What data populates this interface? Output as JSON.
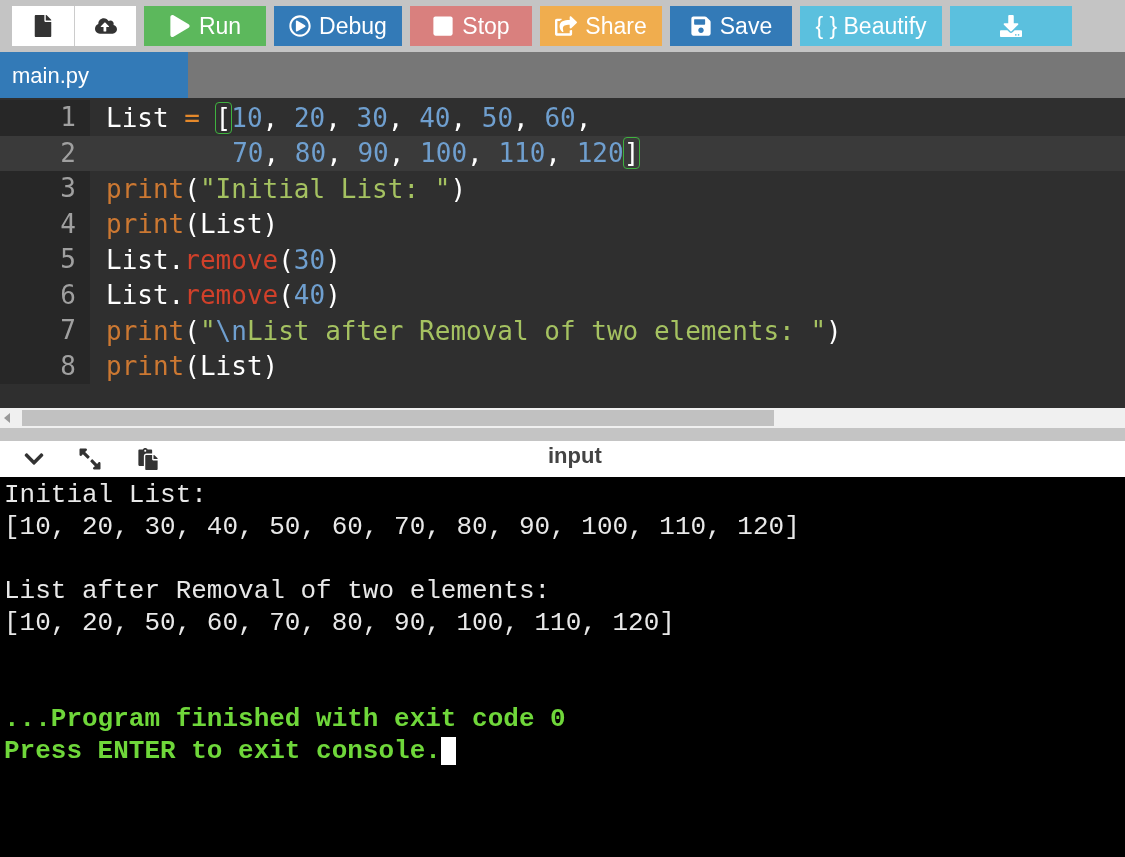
{
  "toolbar": [
    {
      "kind": "new"
    },
    {
      "kind": "upload"
    },
    {
      "kind": "run",
      "label": "Run"
    },
    {
      "kind": "debug",
      "label": "Debug"
    },
    {
      "kind": "stop",
      "label": "Stop"
    },
    {
      "kind": "share",
      "label": "Share"
    },
    {
      "kind": "save",
      "label": "Save"
    },
    {
      "kind": "beautify",
      "label": "{ } Beautify"
    },
    {
      "kind": "download"
    }
  ],
  "tabs": [
    {
      "label": "main.py",
      "selected": true
    }
  ],
  "editor": {
    "lines": [
      {
        "number": "1",
        "tokens": [
          {
            "kind": "plain",
            "text": "List "
          },
          {
            "kind": "op",
            "text": "= "
          },
          {
            "kind": "match",
            "text": "["
          },
          {
            "kind": "num",
            "text": "10"
          },
          {
            "kind": "plain",
            "text": ", "
          },
          {
            "kind": "num",
            "text": "20"
          },
          {
            "kind": "plain",
            "text": ", "
          },
          {
            "kind": "num",
            "text": "30"
          },
          {
            "kind": "plain",
            "text": ", "
          },
          {
            "kind": "num",
            "text": "40"
          },
          {
            "kind": "plain",
            "text": ", "
          },
          {
            "kind": "num",
            "text": "50"
          },
          {
            "kind": "plain",
            "text": ", "
          },
          {
            "kind": "num",
            "text": "60"
          },
          {
            "kind": "plain",
            "text": ","
          }
        ]
      },
      {
        "number": "2",
        "current": true,
        "tokens": [
          {
            "kind": "indent"
          },
          {
            "kind": "num",
            "text": "70"
          },
          {
            "kind": "plain",
            "text": ", "
          },
          {
            "kind": "num",
            "text": "80"
          },
          {
            "kind": "plain",
            "text": ", "
          },
          {
            "kind": "num",
            "text": "90"
          },
          {
            "kind": "plain",
            "text": ", "
          },
          {
            "kind": "num",
            "text": "100"
          },
          {
            "kind": "plain",
            "text": ", "
          },
          {
            "kind": "num",
            "text": "110"
          },
          {
            "kind": "plain",
            "text": ", "
          },
          {
            "kind": "num",
            "text": "120"
          },
          {
            "kind": "match",
            "text": "]"
          }
        ]
      },
      {
        "number": "3",
        "tokens": [
          {
            "kind": "builtin",
            "text": "print"
          },
          {
            "kind": "plain",
            "text": "("
          },
          {
            "kind": "str",
            "text": "\"Initial List: \""
          },
          {
            "kind": "plain",
            "text": ")"
          }
        ]
      },
      {
        "number": "4",
        "tokens": [
          {
            "kind": "builtin",
            "text": "print"
          },
          {
            "kind": "plain",
            "text": "(List)"
          }
        ]
      },
      {
        "number": "5",
        "tokens": [
          {
            "kind": "plain",
            "text": "List."
          },
          {
            "kind": "method",
            "text": "remove"
          },
          {
            "kind": "plain",
            "text": "("
          },
          {
            "kind": "num",
            "text": "30"
          },
          {
            "kind": "plain",
            "text": ")"
          }
        ]
      },
      {
        "number": "6",
        "tokens": [
          {
            "kind": "plain",
            "text": "List."
          },
          {
            "kind": "method",
            "text": "remove"
          },
          {
            "kind": "plain",
            "text": "("
          },
          {
            "kind": "num",
            "text": "40"
          },
          {
            "kind": "plain",
            "text": ")"
          }
        ]
      },
      {
        "number": "7",
        "tokens": [
          {
            "kind": "builtin",
            "text": "print"
          },
          {
            "kind": "plain",
            "text": "("
          },
          {
            "kind": "str",
            "text": "\""
          },
          {
            "kind": "escape",
            "text": "\\n"
          },
          {
            "kind": "str",
            "text": "List after Removal of two elements: \""
          },
          {
            "kind": "plain",
            "text": ")"
          }
        ]
      },
      {
        "number": "8",
        "tokens": [
          {
            "kind": "builtin",
            "text": "print"
          },
          {
            "kind": "plain",
            "text": "(List)"
          }
        ]
      }
    ]
  },
  "console_toolbar": {
    "title": "input"
  },
  "console": [
    {
      "kind": "output",
      "text": "Initial List:"
    },
    {
      "kind": "output",
      "text": "[10, 20, 30, 40, 50, 60, 70, 80, 90, 100, 110, 120]"
    },
    {
      "kind": "blank"
    },
    {
      "kind": "output",
      "text": "List after Removal of two elements:"
    },
    {
      "kind": "output",
      "text": "[10, 20, 50, 60, 70, 80, 90, 100, 110, 120]"
    },
    {
      "kind": "blank"
    },
    {
      "kind": "blank"
    },
    {
      "kind": "status",
      "text": "...Program finished with exit code 0"
    },
    {
      "kind": "status",
      "text": "Press ENTER to exit console.",
      "cursor": true
    }
  ]
}
